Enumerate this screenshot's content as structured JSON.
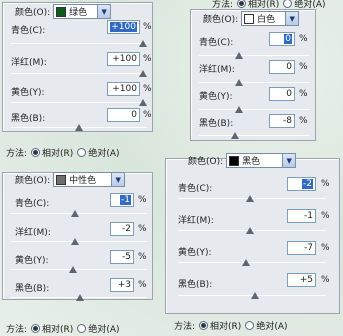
{
  "method_label": "方法:",
  "relative_label": "相对(R)",
  "absolute_label": "绝对(A)",
  "percent_sign": "%",
  "panels": [
    {
      "id": "green",
      "color_label": "颜色(O):",
      "color_name": "绿色",
      "swatch": "#0c5a1e",
      "fields": [
        {
          "label": "青色(C):",
          "value": "+100",
          "highlight": true
        },
        {
          "label": "洋红(M):",
          "value": "+100",
          "highlight": false
        },
        {
          "label": "黄色(Y):",
          "value": "+100",
          "highlight": false
        },
        {
          "label": "黑色(B):",
          "value": "0",
          "highlight": false
        }
      ]
    },
    {
      "id": "white",
      "color_label": "颜色(O):",
      "color_name": "白色",
      "swatch": "#ffffff",
      "fields": [
        {
          "label": "青色(C):",
          "value": "0",
          "highlight": true
        },
        {
          "label": "洋红(M):",
          "value": "0",
          "highlight": false
        },
        {
          "label": "黄色(Y):",
          "value": "0",
          "highlight": false
        },
        {
          "label": "黑色(B):",
          "value": "-8",
          "highlight": false
        }
      ]
    },
    {
      "id": "neutral",
      "color_label": "颜色(O):",
      "color_name": "中性色",
      "swatch": "#6e6e6e",
      "fields": [
        {
          "label": "青色(C):",
          "value": "-1",
          "highlight": true
        },
        {
          "label": "洋红(M):",
          "value": "-2",
          "highlight": false
        },
        {
          "label": "黄色(Y):",
          "value": "-5",
          "highlight": false
        },
        {
          "label": "黑色(B):",
          "value": "+3",
          "highlight": false
        }
      ]
    },
    {
      "id": "black",
      "color_label": "颜色(O):",
      "color_name": "黑色",
      "swatch": "#000000",
      "fields": [
        {
          "label": "青色(C):",
          "value": "-2",
          "highlight": true
        },
        {
          "label": "洋红(M):",
          "value": "-1",
          "highlight": false
        },
        {
          "label": "黄色(Y):",
          "value": "-7",
          "highlight": false
        },
        {
          "label": "黑色(B):",
          "value": "+5",
          "highlight": false
        }
      ]
    }
  ]
}
